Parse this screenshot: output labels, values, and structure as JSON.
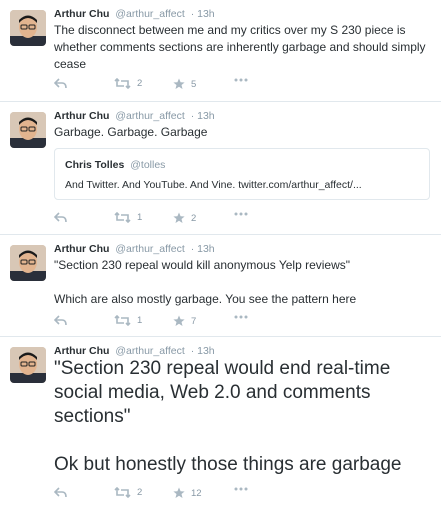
{
  "colors": {
    "accent": "#55acee",
    "muted": "#8899a6",
    "text": "#292f33",
    "divider": "#e1e8ed"
  },
  "tweets": [
    {
      "name": "Arthur Chu",
      "handle": "@arthur_affect",
      "time": "13h",
      "text": "The disconnect between me and my critics over my S 230 piece is whether comments sections are inherently garbage and should simply cease",
      "retweets": "2",
      "likes": "5"
    },
    {
      "name": "Arthur Chu",
      "handle": "@arthur_affect",
      "time": "13h",
      "text": "Garbage. Garbage. Garbage",
      "quote": {
        "name": "Chris Tolles",
        "handle": "@tolles",
        "text": "And Twitter. And YouTube. And Vine. twitter.com/arthur_affect/..."
      },
      "retweets": "1",
      "likes": "2"
    },
    {
      "name": "Arthur Chu",
      "handle": "@arthur_affect",
      "time": "13h",
      "text": "\"Section 230 repeal would kill anonymous Yelp reviews\"\n\nWhich are also mostly garbage. You see the pattern here",
      "retweets": "1",
      "likes": "7"
    },
    {
      "name": "Arthur Chu",
      "handle": "@arthur_affect",
      "time": "13h",
      "text": "\"Section 230 repeal would end real-time social media, Web 2.0 and comments sections\"\n\nOk but honestly those things are garbage",
      "retweets": "2",
      "likes": "12"
    }
  ]
}
